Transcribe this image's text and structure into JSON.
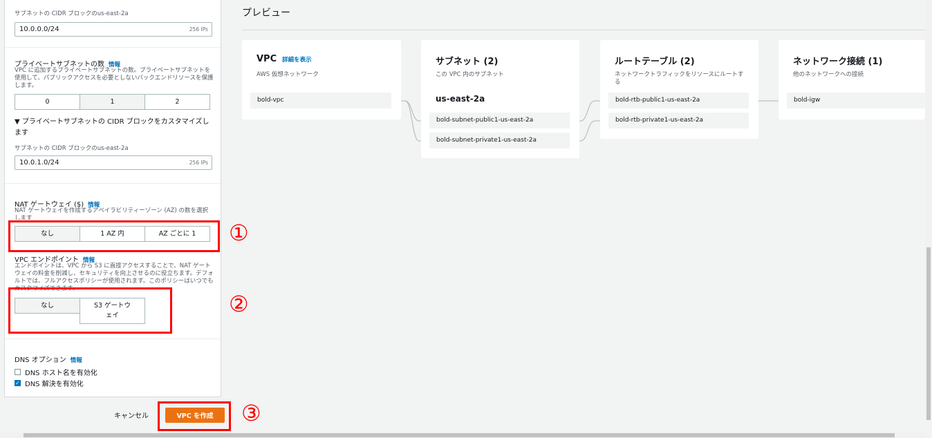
{
  "left": {
    "subnet_cidr_label_1": "サブネットの CIDR ブロックのus-east-2a",
    "cidr_value_1": "10.0.0.0/24",
    "cidr_ips_1": "256 IPs",
    "private_subnet_label": "プライベートサブネットの数",
    "info": "情報",
    "private_subnet_desc": "VPC に追加するプライベートサブネットの数。プライベートサブネットを使用して、パブリックアクセスを必要としないバックエンドリソースを保護します。",
    "private_subnet_options": [
      "0",
      "1",
      "2"
    ],
    "customize_private_cidr": "▼ プライベートサブネットの CIDR ブロックをカスタマイズします",
    "subnet_cidr_label_2": "サブネットの CIDR ブロックのus-east-2a",
    "cidr_value_2": "10.0.1.0/24",
    "cidr_ips_2": "256 IPs",
    "nat_label": "NAT ゲートウェイ ($)",
    "nat_desc": "NAT ゲートウェイを作成するアベイラビリティーゾーン (AZ) の数を選択します",
    "nat_options": [
      "なし",
      "1 AZ 内",
      "AZ ごとに 1"
    ],
    "endpoint_label": "VPC エンドポイント",
    "endpoint_desc": "エンドポイントは、VPC から S3 に直接アクセスすることで、NAT ゲートウェイの料金を削減し、セキュリティを向上させるのに役立ちます。デフォルトでは、フルアクセスポリシーが使用されます。このポリシーはいつでもカスタマイズできます。",
    "endpoint_options": [
      "なし",
      "S3 ゲートウェイ"
    ],
    "dns_label": "DNS オプション",
    "dns_hostnames": "DNS ホスト名を有効化",
    "dns_resolution": "DNS 解決を有効化",
    "dns_hostnames_checked": false,
    "dns_resolution_checked": true
  },
  "footer": {
    "cancel": "キャンセル",
    "create": "VPC を作成"
  },
  "annotations": [
    "①",
    "②",
    "③"
  ],
  "preview": {
    "title": "プレビュー",
    "vpc": {
      "title": "VPC",
      "link": "詳細を表示",
      "sub": "AWS 仮想ネットワーク",
      "node": "bold-vpc"
    },
    "subnets": {
      "title": "サブネット (2)",
      "sub": "この VPC 内のサブネット",
      "az": "us-east-2a",
      "nodes": [
        "bold-subnet-public1-us-east-2a",
        "bold-subnet-private1-us-east-2a"
      ]
    },
    "route_tables": {
      "title": "ルートテーブル (2)",
      "sub": "ネットワークトラフィックをリソースにルートする",
      "nodes": [
        "bold-rtb-public1-us-east-2a",
        "bold-rtb-private1-us-east-2a"
      ]
    },
    "network": {
      "title": "ネットワーク接続 (1)",
      "sub": "他のネットワークへの接続",
      "node": "bold-igw"
    }
  },
  "colors": {
    "accent_orange": "#ec7211",
    "link_blue": "#0073bb",
    "annotation_red": "#ff0000"
  }
}
